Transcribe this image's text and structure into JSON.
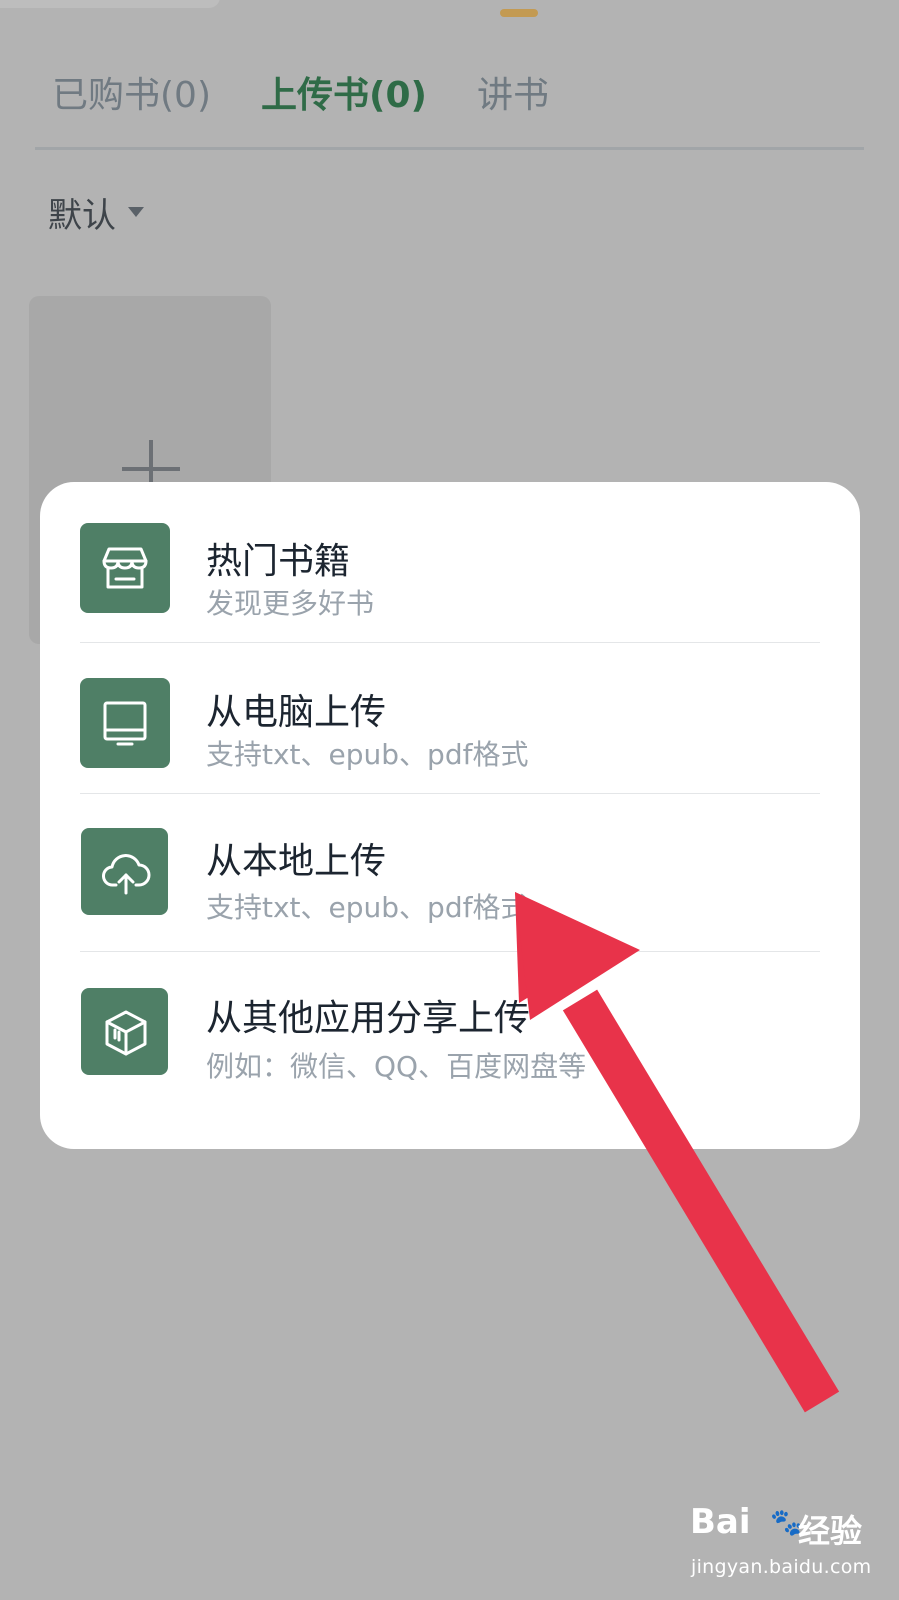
{
  "tabs": [
    {
      "label": "已购书(0)",
      "active": false
    },
    {
      "label": "上传书(0)",
      "active": true
    },
    {
      "label": "讲书",
      "active": false
    }
  ],
  "sort": {
    "label": "默认"
  },
  "add_card": {
    "icon": "plus-icon"
  },
  "menu": {
    "items": [
      {
        "title": "热门书籍",
        "subtitle": "发现更多好书",
        "icon": "store-icon"
      },
      {
        "title": "从电脑上传",
        "subtitle": "支持txt、epub、pdf格式",
        "icon": "monitor-icon"
      },
      {
        "title": "从本地上传",
        "subtitle": "支持txt、epub、pdf格式",
        "icon": "cloud-upload-icon"
      },
      {
        "title": "从其他应用分享上传",
        "subtitle": "例如：微信、QQ、百度网盘等",
        "icon": "box-icon"
      }
    ]
  },
  "annotation": {
    "icon": "red-arrow-icon",
    "color": "#e8334a"
  },
  "watermark": {
    "logo": "Bai",
    "logo_icon": "paw-icon",
    "text": "经验",
    "url": "jingyan.baidu.com"
  },
  "colors": {
    "overlay": "#b3b3b3",
    "accent": "#2f6b47",
    "icon_bg": "#4f7f66"
  }
}
